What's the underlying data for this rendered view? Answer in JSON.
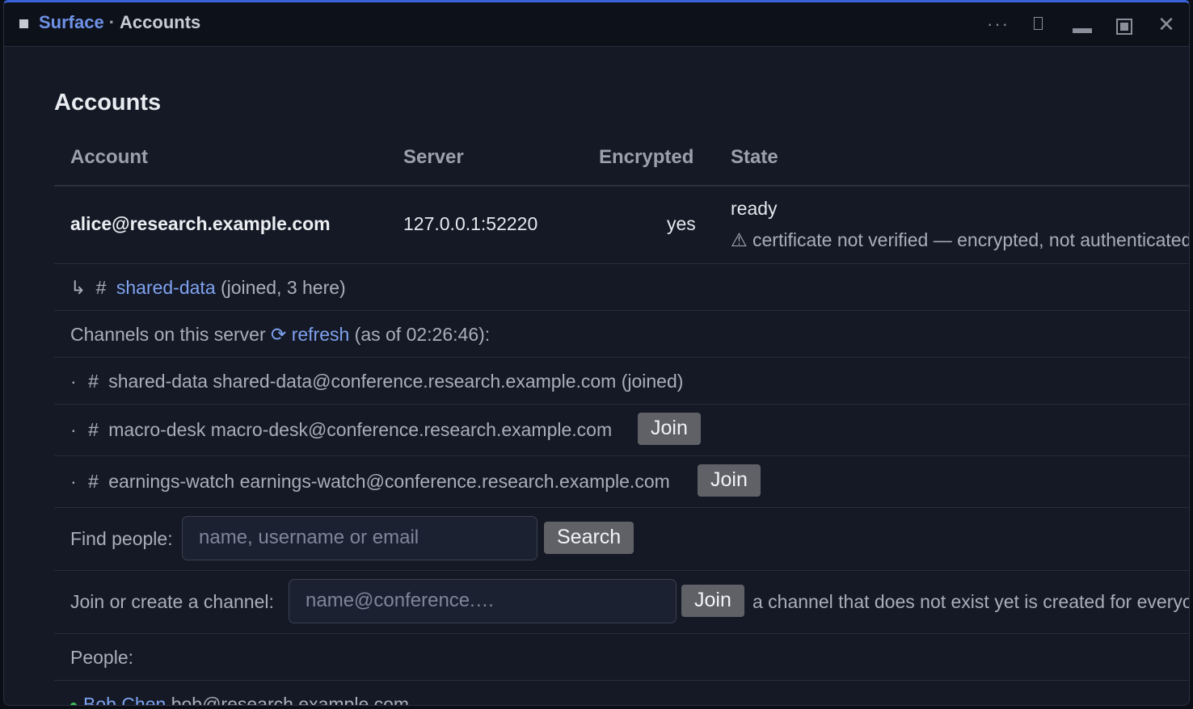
{
  "titlebar": {
    "brand": "Surface",
    "separator": "·",
    "page": "Accounts",
    "controls": {
      "more": "···",
      "close": "✕"
    }
  },
  "page_title": "Accounts",
  "table": {
    "headers": {
      "account": "Account",
      "server": "Server",
      "encrypted": "Encrypted",
      "state": "State"
    },
    "account_row": {
      "account": "alice@research.example.com",
      "server": "127.0.0.1:52220",
      "encrypted": "yes",
      "state": "ready",
      "warning": "⚠ certificate not verified — encrypted, not authenticated"
    }
  },
  "joined_channel": {
    "arrow": "↳",
    "hash": "#",
    "name": "shared-data",
    "suffix": "(joined, 3 here)"
  },
  "channels_header": {
    "prefix": "Channels on this server",
    "refresh_icon": "⟳",
    "refresh_label": "refresh",
    "suffix": "(as of 02:26:46):"
  },
  "channels": [
    {
      "bullet": "·",
      "hash": "#",
      "name": "shared-data",
      "jid": "shared-data@conference.research.example.com",
      "status": "(joined)"
    },
    {
      "bullet": "·",
      "hash": "#",
      "name": "macro-desk",
      "jid": "macro-desk@conference.research.example.com",
      "join_label": "Join"
    },
    {
      "bullet": "·",
      "hash": "#",
      "name": "earnings-watch",
      "jid": "earnings-watch@conference.research.example.com",
      "join_label": "Join"
    }
  ],
  "find_people": {
    "label": "Find people:",
    "placeholder": "name, username or email",
    "button": "Search"
  },
  "join_channel": {
    "label": "Join or create a channel:",
    "placeholder": "name@conference.…",
    "button": "Join",
    "hint": "a channel that does not exist yet is created for everyone"
  },
  "people": {
    "label": "People:",
    "items": [
      {
        "name": "Bob Chen",
        "email": "bob@research.example.com",
        "status_color": "#3dbf5a"
      }
    ]
  },
  "colors": {
    "accent": "#3b63d8",
    "link": "#7fa2f0",
    "button_bg": "#5f6166"
  }
}
